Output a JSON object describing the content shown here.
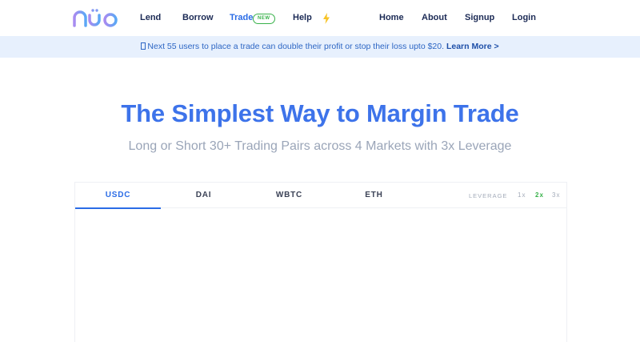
{
  "header": {
    "logo_text": "nuo",
    "nav_left": [
      {
        "label": "Lend"
      },
      {
        "label": "Borrow"
      },
      {
        "label": "Trade",
        "badge": "NEW"
      },
      {
        "label": "Help"
      }
    ],
    "nav_right": [
      {
        "label": "Home"
      },
      {
        "label": "About"
      },
      {
        "label": "Signup"
      },
      {
        "label": "Login"
      }
    ]
  },
  "announcement": {
    "text": "Next 55 users to place a trade can double their profit or stop their loss upto $20.",
    "link": "Learn More >"
  },
  "hero": {
    "title": "The Simplest Way to Margin Trade",
    "subtitle": "Long or Short 30+ Trading Pairs across 4 Markets with 3x Leverage"
  },
  "panel": {
    "tabs": [
      {
        "label": "USDC"
      },
      {
        "label": "DAI"
      },
      {
        "label": "WBTC"
      },
      {
        "label": "ETH"
      }
    ],
    "active_tab": "USDC",
    "leverage": {
      "label": "LEVERAGE",
      "options": [
        "1x",
        "2x",
        "3x"
      ],
      "selected": "2x"
    }
  },
  "colors": {
    "brand_blue": "#3d73ea",
    "nav_text": "#1b2a55",
    "accent_green": "#38b24a",
    "announce_bg": "#e7f0fd",
    "logo_gradient": [
      "#a98bf0",
      "#5aa8f5"
    ],
    "bolt": "#f7c325"
  }
}
